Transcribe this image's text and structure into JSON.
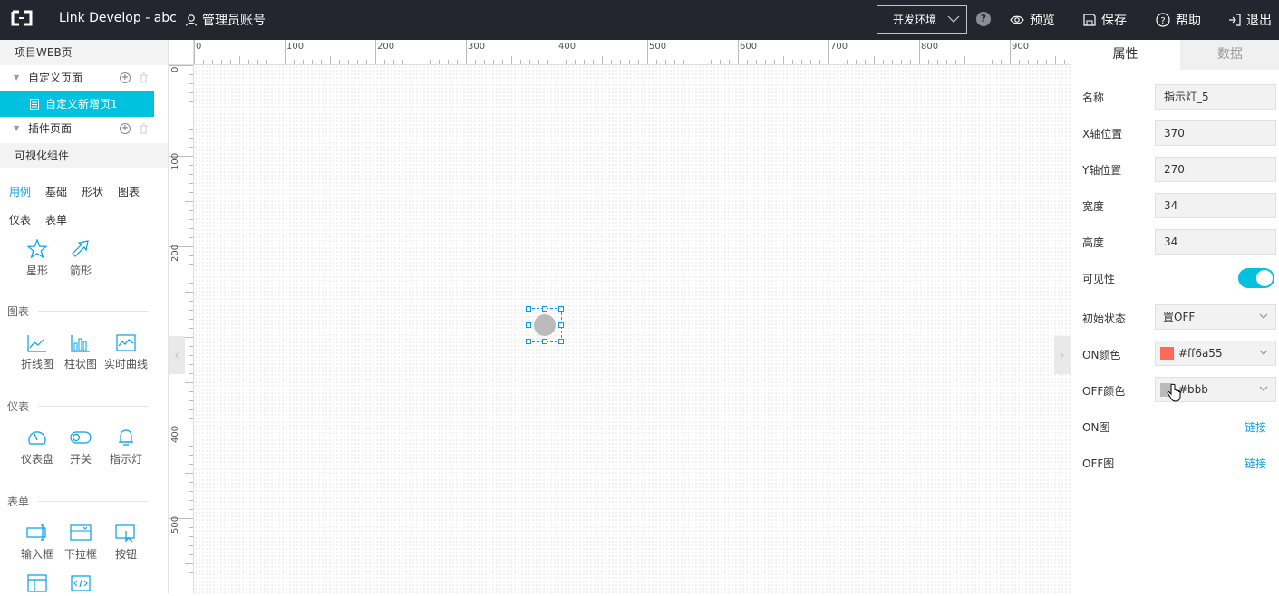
{
  "header": {
    "title": "Link Develop - abc",
    "account": "管理员账号",
    "env_select": "开发环境",
    "actions": {
      "preview": "预览",
      "save": "保存",
      "help": "帮助",
      "logout": "退出"
    }
  },
  "left": {
    "project_section": "项目WEB页",
    "tree": {
      "custom_pages": "自定义页面",
      "selected_page": "自定义新增页1",
      "plugin_pages": "插件页面"
    },
    "components_section": "可视化组件",
    "tabs": [
      "用例",
      "基础",
      "形状",
      "图表",
      "仪表",
      "表单"
    ],
    "example_items": [
      "星形",
      "箭形"
    ],
    "groups": {
      "chart": {
        "title": "图表",
        "items": [
          "折线图",
          "柱状图",
          "实时曲线"
        ]
      },
      "gauge": {
        "title": "仪表",
        "items": [
          "仪表盘",
          "开关",
          "指示灯"
        ]
      },
      "form": {
        "title": "表单",
        "items": [
          "输入框",
          "下拉框",
          "按钮"
        ]
      }
    }
  },
  "canvas": {
    "ruler_h": [
      "0",
      "100",
      "200",
      "300",
      "400",
      "500",
      "600",
      "700",
      "800",
      "900"
    ],
    "ruler_v": [
      "0",
      "100",
      "200",
      "400",
      "500"
    ]
  },
  "properties": {
    "tab_properties": "属性",
    "tab_data": "数据",
    "name_label": "名称",
    "name_value": "指示灯_5",
    "x_label": "X轴位置",
    "x_value": "370",
    "y_label": "Y轴位置",
    "y_value": "270",
    "width_label": "宽度",
    "width_value": "34",
    "height_label": "高度",
    "height_value": "34",
    "visible_label": "可见性",
    "initial_label": "初始状态",
    "initial_value": "置OFF",
    "on_color_label": "ON颜色",
    "on_color_value": "#ff6a55",
    "off_color_label": "OFF颜色",
    "off_color_value": "#bbb",
    "on_image_label": "ON图",
    "off_image_label": "OFF图",
    "link_text": "链接"
  },
  "colors": {
    "accent": "#00c1de",
    "link": "#00a1e9",
    "on": "#ff6a55",
    "off": "#bbbbbb"
  }
}
